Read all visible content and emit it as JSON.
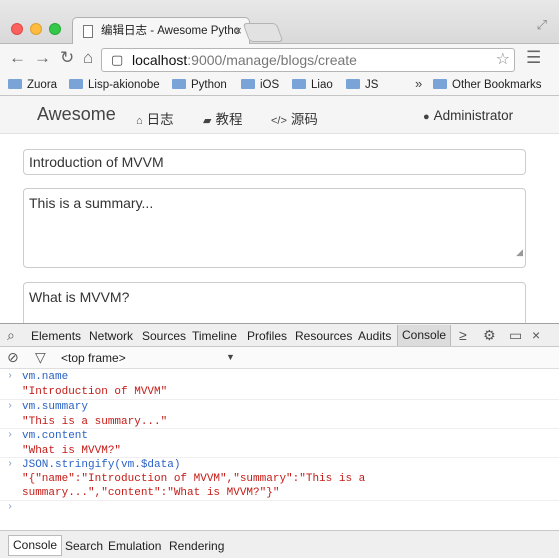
{
  "browser": {
    "tab_title": "编辑日志 - Awesome Pytho",
    "address_host": "localhost",
    "address_path": ":9000/manage/blogs/create",
    "bookmarks": [
      "Zuora",
      "Lisp-akionobe",
      "Python",
      "iOS",
      "Liao",
      "JS"
    ],
    "bookmarks_more": "»",
    "other_bookmarks": "Other Bookmarks"
  },
  "app": {
    "brand": "Awesome",
    "nav": [
      {
        "label": "日志",
        "icon": "home-icon"
      },
      {
        "label": "教程",
        "icon": "book-icon"
      },
      {
        "label": "源码",
        "icon": "code-icon"
      }
    ],
    "user": "Administrator",
    "form": {
      "name": "Introduction of MVVM",
      "summary": "This is a summary...",
      "content": "What is MVVM?"
    }
  },
  "devtools": {
    "tabs": [
      "Elements",
      "Network",
      "Sources",
      "Timeline",
      "Profiles",
      "Resources",
      "Audits",
      "Console"
    ],
    "active_tab": "Console",
    "frame": "<top frame>",
    "console": [
      {
        "cmd": "vm.name",
        "result": "\"Introduction of MVVM\""
      },
      {
        "cmd": "vm.summary",
        "result": "\"This is a summary...\""
      },
      {
        "cmd": "vm.content",
        "result": "\"What is MVVM?\""
      },
      {
        "cmd": "JSON.stringify(vm.$data)",
        "result": "\"{\"name\":\"Introduction of MVVM\",\"summary\":\"This is a summary...\",\"content\":\"What is MVVM?\"}\""
      }
    ],
    "drawer_tabs": [
      "Console",
      "Search",
      "Emulation",
      "Rendering"
    ]
  }
}
